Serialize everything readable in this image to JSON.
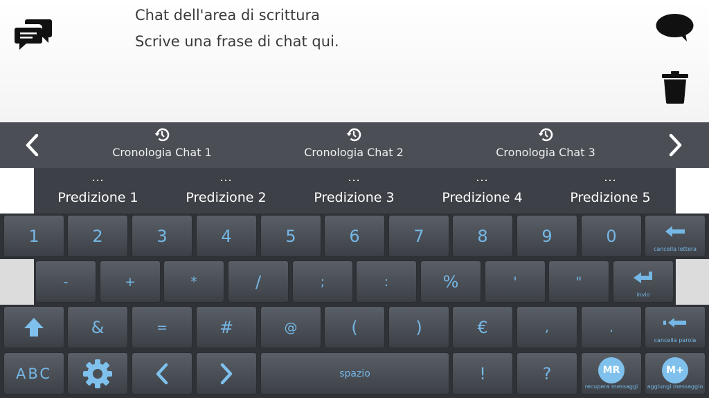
{
  "writing_area": {
    "title": "Chat dell'area di scrittura",
    "text": "Scrive una frase di chat qui."
  },
  "icons": {
    "chat": "chat-bubbles-icon",
    "speak": "speech-bubble-icon",
    "delete": "trash-icon",
    "history": "history-clock-icon",
    "prev": "chevron-left-icon",
    "next": "chevron-right-icon",
    "shift": "shift-arrow-icon",
    "settings": "gear-icon",
    "backspace": "backspace-arrow-icon",
    "enter": "enter-return-icon",
    "delete_word": "delete-word-icon"
  },
  "history": [
    {
      "label": "Cronologia Chat 1"
    },
    {
      "label": "Cronologia Chat 2"
    },
    {
      "label": "Cronologia Chat 3"
    }
  ],
  "predictions": [
    {
      "dots": "...",
      "label": "Predizione 1"
    },
    {
      "dots": "...",
      "label": "Predizione 2"
    },
    {
      "dots": "...",
      "label": "Predizione 3"
    },
    {
      "dots": "...",
      "label": "Predizione 4"
    },
    {
      "dots": "...",
      "label": "Predizione 5"
    }
  ],
  "keyboard": {
    "row1": [
      "1",
      "2",
      "3",
      "4",
      "5",
      "6",
      "7",
      "8",
      "9",
      "0"
    ],
    "row1_backspace_caption": "cancella lettera",
    "row2": [
      "-",
      "+",
      "*",
      "/",
      ";",
      ":",
      "%",
      "'",
      "\""
    ],
    "row2_enter_caption": "invio",
    "row3": [
      "&",
      "=",
      "#",
      "@",
      "(",
      ")",
      "€",
      ",",
      "."
    ],
    "row3_delete_word_caption": "cancella parola",
    "abc_label": "ABC",
    "space_label": "spazio",
    "exclamation": "!",
    "question": "?",
    "mr_label": "MR",
    "mr_caption": "recupera messaggi",
    "mplus_label": "M+",
    "mplus_caption": "aggiungi messaggio"
  },
  "colors": {
    "key_text": "#75b7e6",
    "history_bar": "#4b4f55",
    "prediction_bar": "#3d4046",
    "circle_button": "#7fc1ec"
  }
}
